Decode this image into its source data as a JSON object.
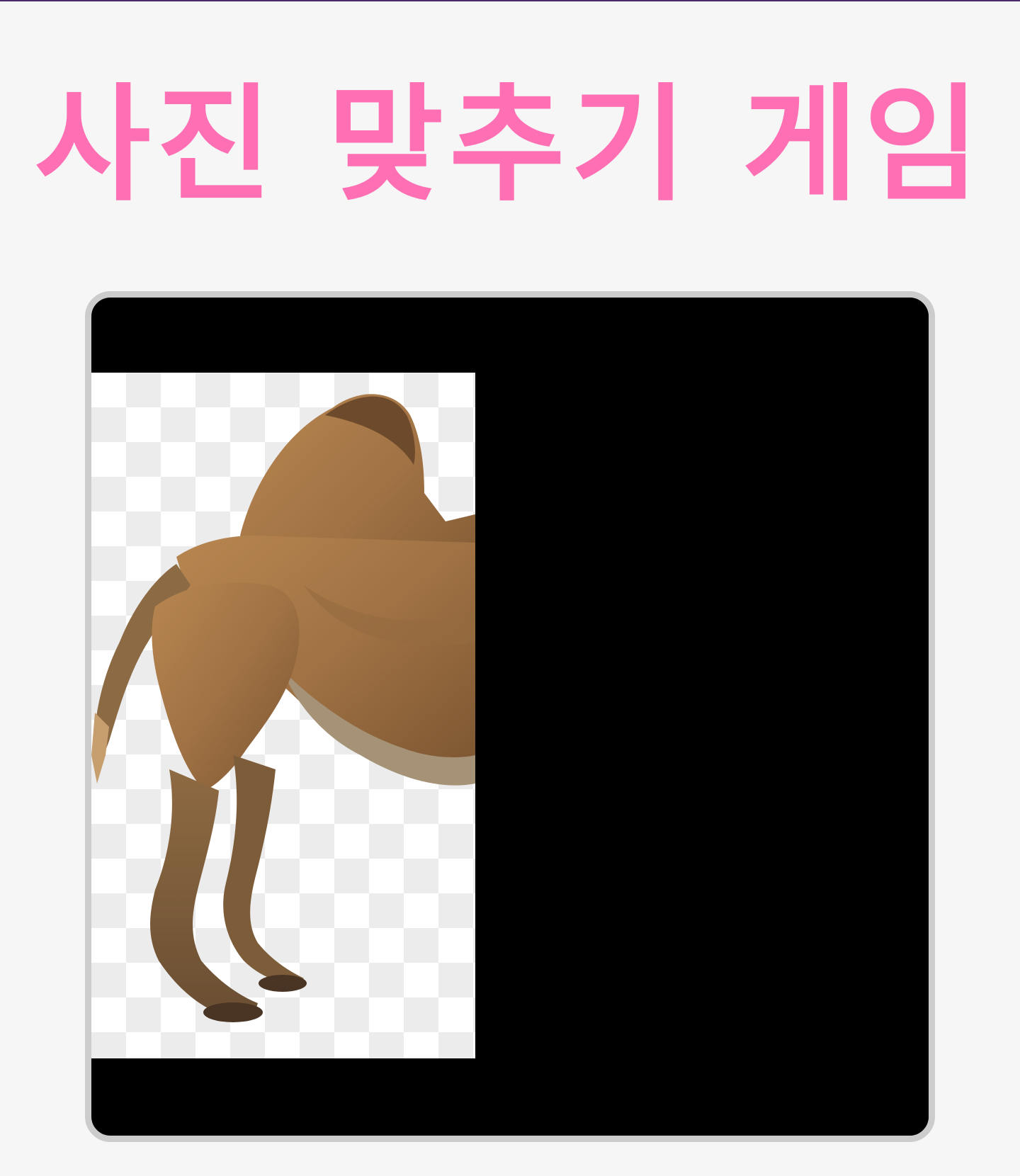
{
  "game": {
    "title": "사진 맞추기 게임"
  },
  "puzzle": {
    "subject_icon": "camel-icon",
    "revealed_fraction": 0.45,
    "colors": {
      "title": "#ff6fb4",
      "frame_border": "#cccccc",
      "frame_background": "#000000"
    }
  }
}
